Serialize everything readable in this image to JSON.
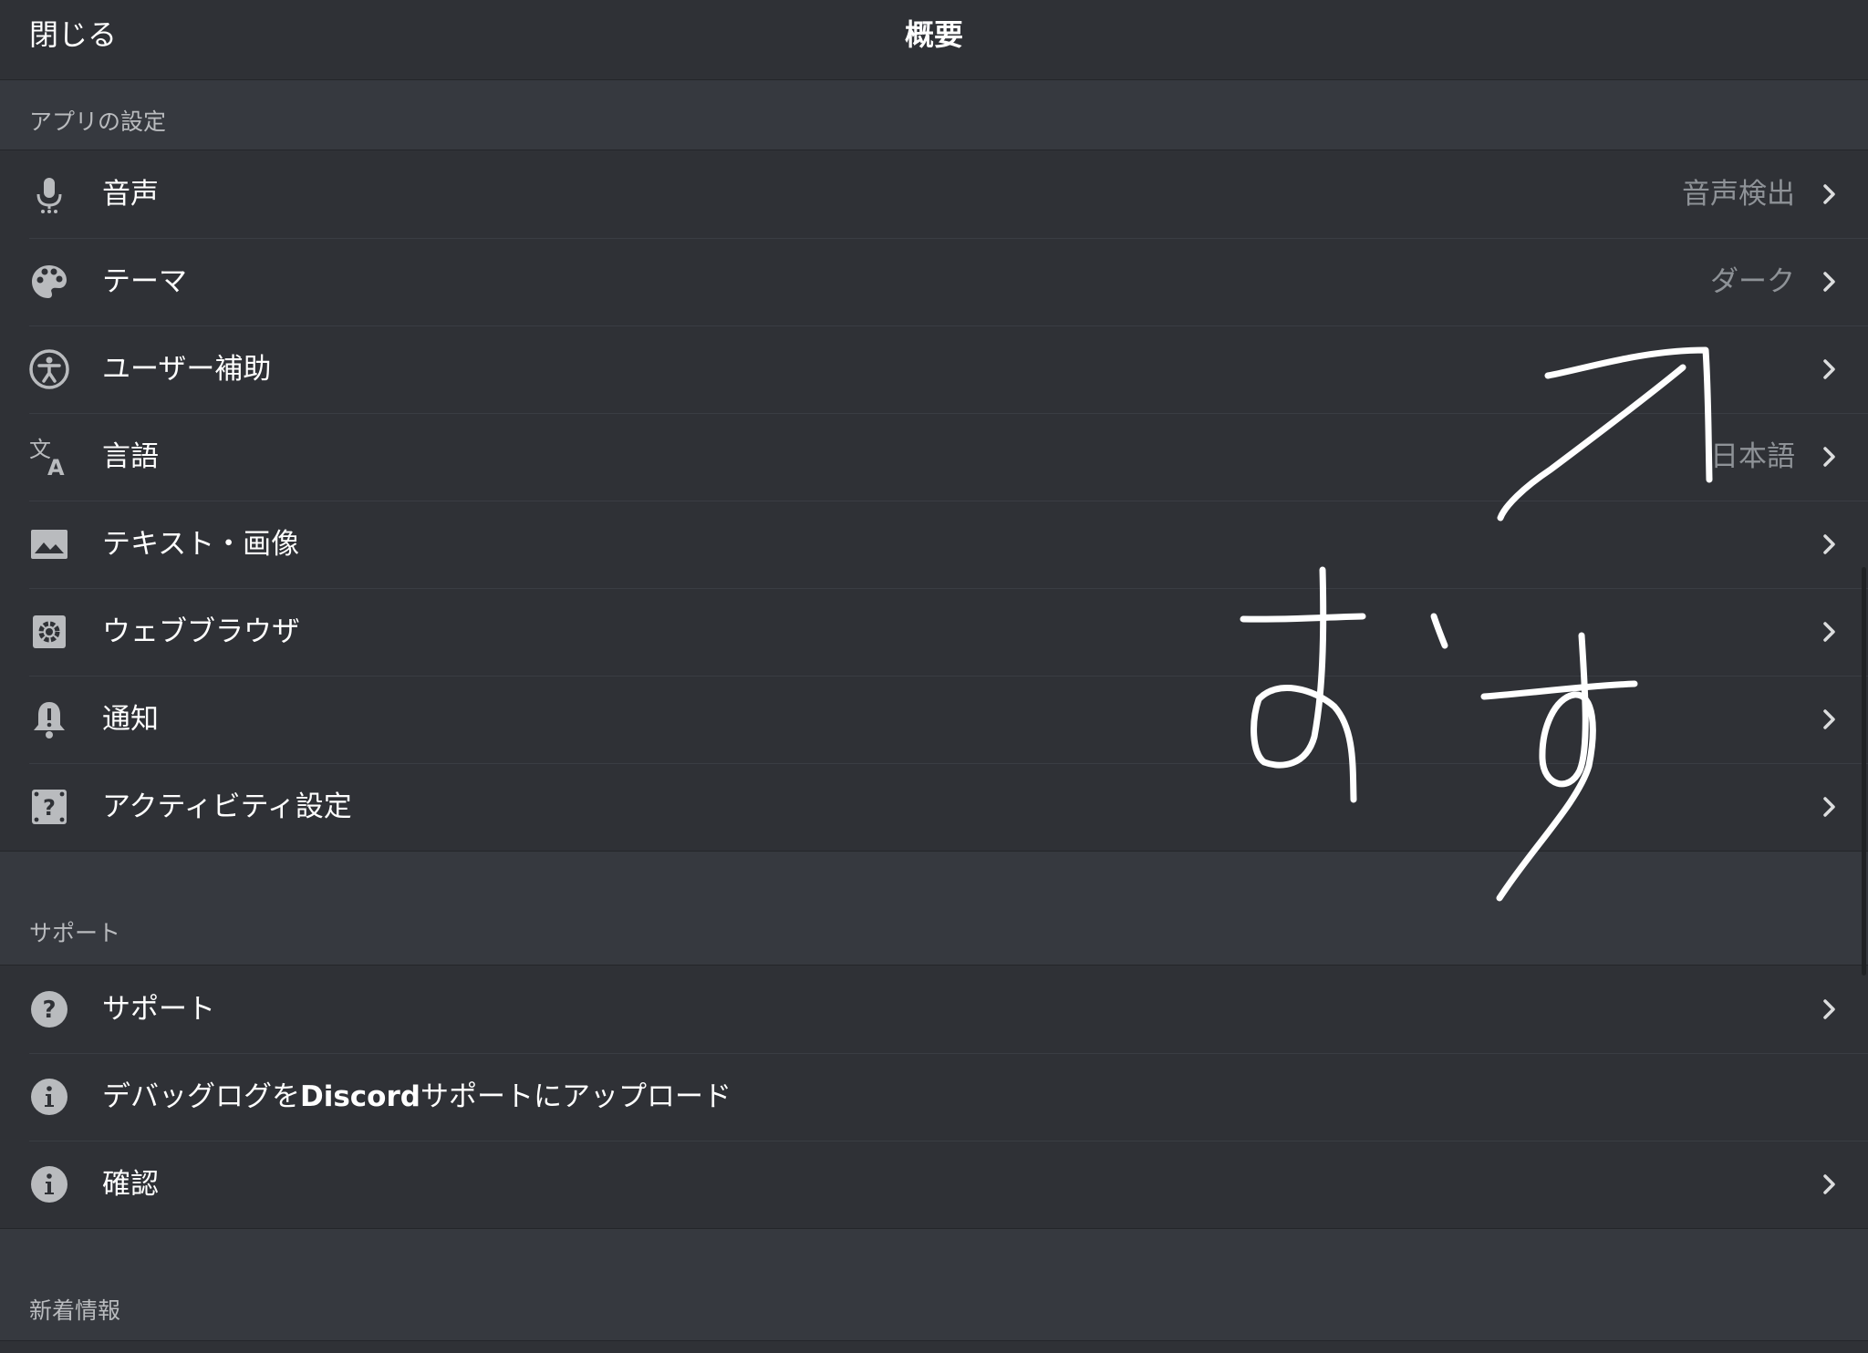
{
  "header": {
    "close_label": "閉じる",
    "title": "概要"
  },
  "sections": {
    "app_settings": "アプリの設定",
    "support": "サポート",
    "whats_new": "新着情報"
  },
  "app_settings_items": [
    {
      "label": "音声",
      "value": "音声検出",
      "icon": "microphone-icon"
    },
    {
      "label": "テーマ",
      "value": "ダーク",
      "icon": "palette-icon"
    },
    {
      "label": "ユーザー補助",
      "value": "",
      "icon": "accessibility-icon"
    },
    {
      "label": "言語",
      "value": "日本語",
      "icon": "translate-icon"
    },
    {
      "label": "テキスト・画像",
      "value": "",
      "icon": "image-icon"
    },
    {
      "label": "ウェブブラウザ",
      "value": "",
      "icon": "settings-gear-icon"
    },
    {
      "label": "通知",
      "value": "",
      "icon": "bell-alert-icon"
    },
    {
      "label": "アクティビティ設定",
      "value": "",
      "icon": "activity-icon"
    }
  ],
  "support_items": [
    {
      "label": "サポート",
      "icon": "help-circle-icon"
    },
    {
      "label_prefix": "デバッグログを",
      "label_bold": "Discord",
      "label_suffix": "サポートにアップロード",
      "icon": "info-circle-icon"
    },
    {
      "label": "確認",
      "icon": "info-circle-icon"
    }
  ],
  "annotation": {
    "handwritten_text": "おす"
  },
  "colors": {
    "background": "#36393f",
    "row_background": "#2f3136",
    "text_primary": "#ffffff",
    "text_muted": "#8e9297",
    "icon": "#b9bbbe"
  }
}
